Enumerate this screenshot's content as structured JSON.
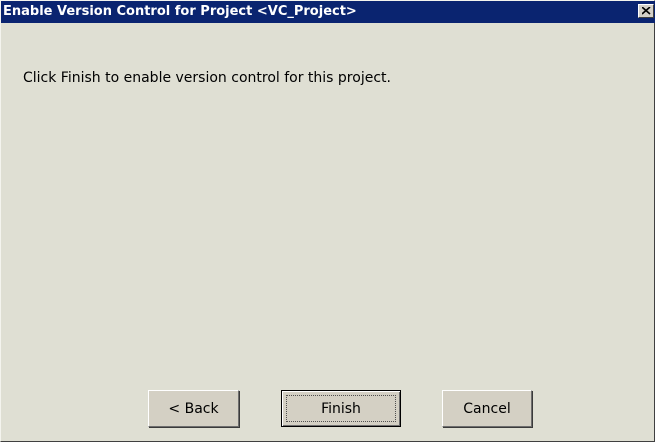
{
  "window": {
    "title": "Enable Version Control for Project <VC_Project>",
    "close_icon": "close-icon"
  },
  "content": {
    "message": "Click Finish to enable version control for this project."
  },
  "buttons": {
    "back_label": "< Back",
    "finish_label": "Finish",
    "cancel_label": "Cancel"
  },
  "colors": {
    "titlebar": "#0a2470",
    "dialog_background": "#dfdfd3",
    "button_face": "#d4d0c4"
  }
}
